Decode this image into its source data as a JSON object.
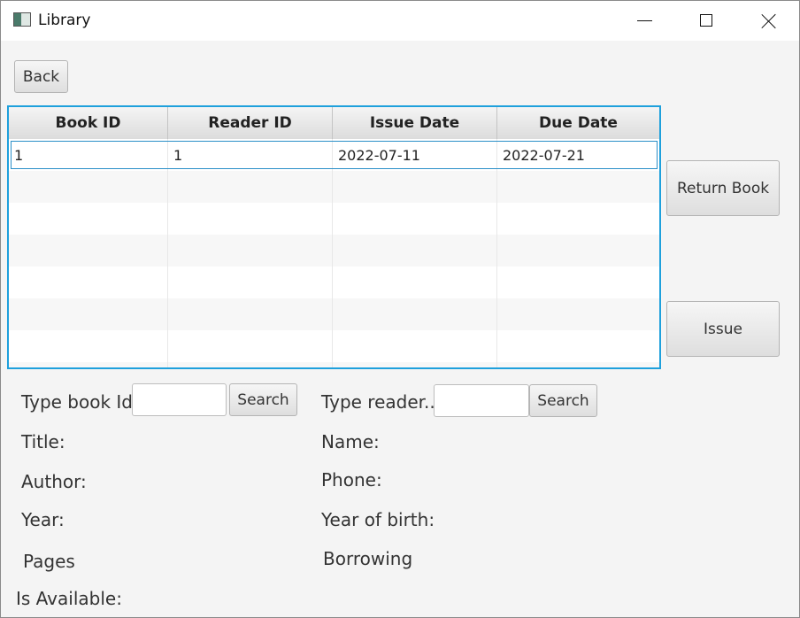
{
  "window": {
    "title": "Library"
  },
  "toolbar": {
    "back_label": "Back"
  },
  "table": {
    "columns": [
      "Book ID",
      "Reader ID",
      "Issue Date",
      "Due Date"
    ],
    "rows": [
      [
        "1",
        "1",
        "2022-07-11",
        "2022-07-21"
      ]
    ]
  },
  "actions": {
    "return_label": "Return Book",
    "issue_label": "Issue"
  },
  "book": {
    "search_prompt": "Type book Id:",
    "search_value": "",
    "search_button": "Search",
    "title_label": "Title:",
    "author_label": "Author:",
    "year_label": "Year:",
    "pages_label": "Pages",
    "available_label": "Is Available:"
  },
  "reader": {
    "search_prompt": "Type reader...",
    "search_value": "",
    "search_button": "Search",
    "name_label": "Name:",
    "phone_label": "Phone:",
    "birth_label": "Year of birth:",
    "borrowing_label": "Borrowing"
  }
}
